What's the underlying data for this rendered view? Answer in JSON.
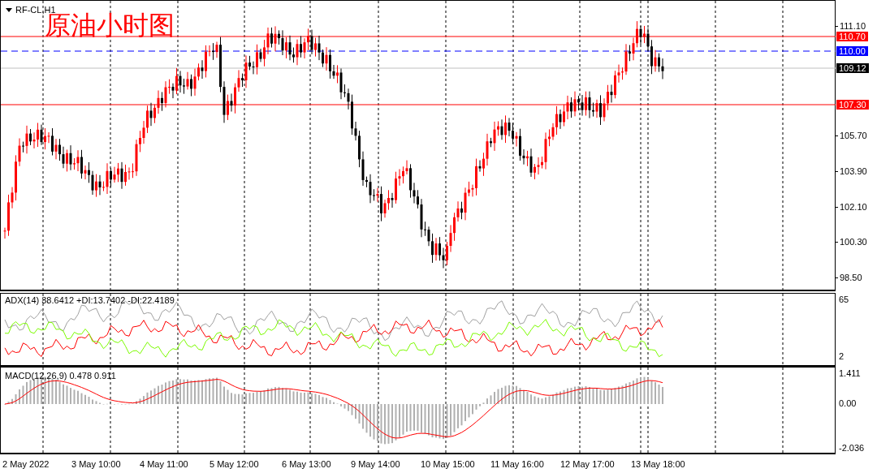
{
  "chart": {
    "symbol": "RF-CL,H1",
    "title": "原油小时图",
    "price_labels": [
      "111.10",
      "105.70",
      "103.90",
      "102.10",
      "100.30",
      "98.50"
    ],
    "levels": [
      {
        "price": "110.70",
        "kind": "level",
        "color": "#ff0000"
      },
      {
        "price": "110.00",
        "kind": "dashed",
        "color": "#0000ff"
      },
      {
        "price": "109.12",
        "kind": "bid",
        "color": "#000000"
      },
      {
        "price": "107.30",
        "kind": "level",
        "color": "#ff0000"
      }
    ]
  },
  "adx": {
    "label": "ADX(14) 38.6412 +DI:13.7402 -DI:22.4189",
    "axis": [
      "65",
      "2"
    ]
  },
  "macd": {
    "label": "MACD(12,26,9) 0.478 0.911",
    "axis": [
      "1.411",
      "0.00",
      "-2.036"
    ]
  },
  "time_axis": [
    "2 May 2022",
    "3 May 10:00",
    "4 May 11:00",
    "5 May 12:00",
    "6 May 13:00",
    "9 May 14:00",
    "10 May 15:00",
    "11 May 16:00",
    "12 May 17:00",
    "13 May 18:00"
  ]
}
